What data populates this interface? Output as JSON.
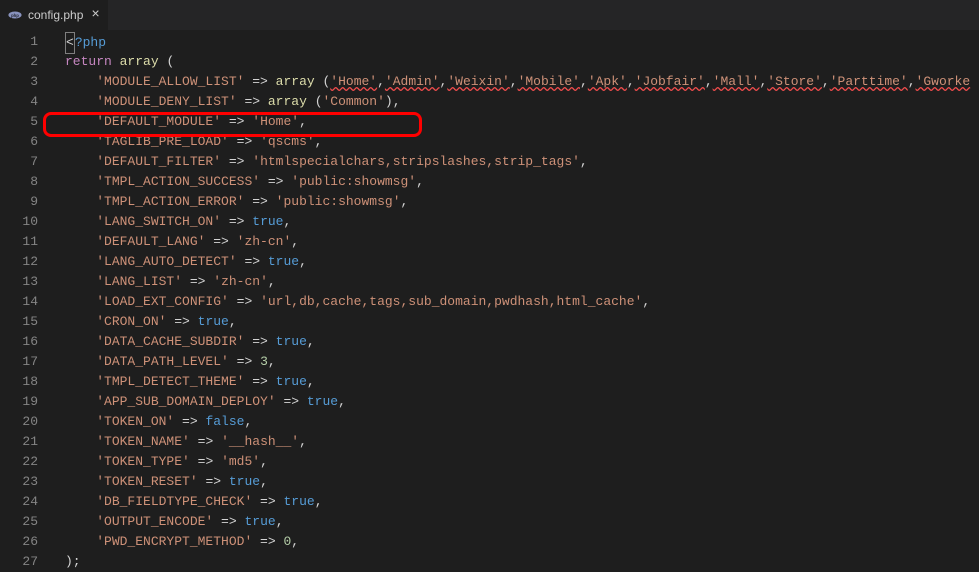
{
  "tab": {
    "label": "config.php",
    "icon": "php-icon"
  },
  "code": {
    "lines": [
      {
        "n": 1,
        "segs": [
          {
            "t": "<",
            "c": "k-punct",
            "box": true
          },
          {
            "t": "?php",
            "c": "k-php"
          }
        ]
      },
      {
        "n": 2,
        "segs": [
          {
            "t": "return",
            "c": "k-purple"
          },
          {
            "t": " ",
            "c": ""
          },
          {
            "t": "array",
            "c": "k-func"
          },
          {
            "t": " (",
            "c": "k-punct"
          }
        ]
      },
      {
        "n": 3,
        "indent": 1,
        "segs": [
          {
            "t": "'MODULE_ALLOW_LIST'",
            "c": "k-string"
          },
          {
            "t": " => ",
            "c": "k-punct"
          },
          {
            "t": "array",
            "c": "k-func"
          },
          {
            "t": " (",
            "c": "k-punct"
          },
          {
            "t": "'Home'",
            "c": "k-string",
            "err": true
          },
          {
            "t": ",",
            "c": "k-punct"
          },
          {
            "t": "'Admin'",
            "c": "k-string",
            "err": true
          },
          {
            "t": ",",
            "c": "k-punct"
          },
          {
            "t": "'Weixin'",
            "c": "k-string",
            "err": true
          },
          {
            "t": ",",
            "c": "k-punct"
          },
          {
            "t": "'Mobile'",
            "c": "k-string",
            "err": true
          },
          {
            "t": ",",
            "c": "k-punct"
          },
          {
            "t": "'Apk'",
            "c": "k-string",
            "err": true
          },
          {
            "t": ",",
            "c": "k-punct"
          },
          {
            "t": "'Jobfair'",
            "c": "k-string",
            "err": true
          },
          {
            "t": ",",
            "c": "k-punct"
          },
          {
            "t": "'Mall'",
            "c": "k-string",
            "err": true
          },
          {
            "t": ",",
            "c": "k-punct"
          },
          {
            "t": "'Store'",
            "c": "k-string",
            "err": true
          },
          {
            "t": ",",
            "c": "k-punct"
          },
          {
            "t": "'Parttime'",
            "c": "k-string",
            "err": true
          },
          {
            "t": ",",
            "c": "k-punct"
          },
          {
            "t": "'Gworke",
            "c": "k-string",
            "err": true
          }
        ]
      },
      {
        "n": 4,
        "indent": 1,
        "segs": [
          {
            "t": "'MODULE_DENY_LIST'",
            "c": "k-string"
          },
          {
            "t": " => ",
            "c": "k-punct"
          },
          {
            "t": "array",
            "c": "k-func"
          },
          {
            "t": " (",
            "c": "k-punct"
          },
          {
            "t": "'Common'",
            "c": "k-string"
          },
          {
            "t": "),",
            "c": "k-punct"
          }
        ]
      },
      {
        "n": 5,
        "indent": 1,
        "segs": [
          {
            "t": "'DEFAULT_MODULE'",
            "c": "k-string"
          },
          {
            "t": " => ",
            "c": "k-punct"
          },
          {
            "t": "'Home'",
            "c": "k-string"
          },
          {
            "t": ",",
            "c": "k-punct"
          }
        ]
      },
      {
        "n": 6,
        "indent": 1,
        "segs": [
          {
            "t": "'TAGLIB_PRE_LOAD'",
            "c": "k-string"
          },
          {
            "t": " => ",
            "c": "k-punct"
          },
          {
            "t": "'qscms'",
            "c": "k-string"
          },
          {
            "t": ",",
            "c": "k-punct"
          }
        ]
      },
      {
        "n": 7,
        "indent": 1,
        "segs": [
          {
            "t": "'DEFAULT_FILTER'",
            "c": "k-string"
          },
          {
            "t": " => ",
            "c": "k-punct"
          },
          {
            "t": "'htmlspecialchars,stripslashes,strip_tags'",
            "c": "k-string"
          },
          {
            "t": ",",
            "c": "k-punct"
          }
        ]
      },
      {
        "n": 8,
        "indent": 1,
        "segs": [
          {
            "t": "'TMPL_ACTION_SUCCESS'",
            "c": "k-string"
          },
          {
            "t": " => ",
            "c": "k-punct"
          },
          {
            "t": "'public:showmsg'",
            "c": "k-string"
          },
          {
            "t": ",",
            "c": "k-punct"
          }
        ]
      },
      {
        "n": 9,
        "indent": 1,
        "segs": [
          {
            "t": "'TMPL_ACTION_ERROR'",
            "c": "k-string"
          },
          {
            "t": " => ",
            "c": "k-punct"
          },
          {
            "t": "'public:showmsg'",
            "c": "k-string"
          },
          {
            "t": ",",
            "c": "k-punct"
          }
        ]
      },
      {
        "n": 10,
        "indent": 1,
        "segs": [
          {
            "t": "'LANG_SWITCH_ON'",
            "c": "k-string"
          },
          {
            "t": " => ",
            "c": "k-punct"
          },
          {
            "t": "true",
            "c": "k-const"
          },
          {
            "t": ",",
            "c": "k-punct"
          }
        ]
      },
      {
        "n": 11,
        "indent": 1,
        "segs": [
          {
            "t": "'DEFAULT_LANG'",
            "c": "k-string"
          },
          {
            "t": " => ",
            "c": "k-punct"
          },
          {
            "t": "'zh-cn'",
            "c": "k-string"
          },
          {
            "t": ",",
            "c": "k-punct"
          }
        ]
      },
      {
        "n": 12,
        "indent": 1,
        "segs": [
          {
            "t": "'LANG_AUTO_DETECT'",
            "c": "k-string"
          },
          {
            "t": " => ",
            "c": "k-punct"
          },
          {
            "t": "true",
            "c": "k-const"
          },
          {
            "t": ",",
            "c": "k-punct"
          }
        ]
      },
      {
        "n": 13,
        "indent": 1,
        "segs": [
          {
            "t": "'LANG_LIST'",
            "c": "k-string"
          },
          {
            "t": " => ",
            "c": "k-punct"
          },
          {
            "t": "'zh-cn'",
            "c": "k-string"
          },
          {
            "t": ",",
            "c": "k-punct"
          }
        ]
      },
      {
        "n": 14,
        "indent": 1,
        "segs": [
          {
            "t": "'LOAD_EXT_CONFIG'",
            "c": "k-string"
          },
          {
            "t": " => ",
            "c": "k-punct"
          },
          {
            "t": "'url,db,cache,tags,sub_domain,pwdhash,html_cache'",
            "c": "k-string"
          },
          {
            "t": ",",
            "c": "k-punct"
          }
        ]
      },
      {
        "n": 15,
        "indent": 1,
        "segs": [
          {
            "t": "'CRON_ON'",
            "c": "k-string"
          },
          {
            "t": " => ",
            "c": "k-punct"
          },
          {
            "t": "true",
            "c": "k-const"
          },
          {
            "t": ",",
            "c": "k-punct"
          }
        ]
      },
      {
        "n": 16,
        "indent": 1,
        "segs": [
          {
            "t": "'DATA_CACHE_SUBDIR'",
            "c": "k-string"
          },
          {
            "t": " => ",
            "c": "k-punct"
          },
          {
            "t": "true",
            "c": "k-const"
          },
          {
            "t": ",",
            "c": "k-punct"
          }
        ]
      },
      {
        "n": 17,
        "indent": 1,
        "segs": [
          {
            "t": "'DATA_PATH_LEVEL'",
            "c": "k-string"
          },
          {
            "t": " => ",
            "c": "k-punct"
          },
          {
            "t": "3",
            "c": "k-num"
          },
          {
            "t": ",",
            "c": "k-punct"
          }
        ]
      },
      {
        "n": 18,
        "indent": 1,
        "segs": [
          {
            "t": "'TMPL_DETECT_THEME'",
            "c": "k-string"
          },
          {
            "t": " => ",
            "c": "k-punct"
          },
          {
            "t": "true",
            "c": "k-const"
          },
          {
            "t": ",",
            "c": "k-punct"
          }
        ]
      },
      {
        "n": 19,
        "indent": 1,
        "segs": [
          {
            "t": "'APP_SUB_DOMAIN_DEPLOY'",
            "c": "k-string"
          },
          {
            "t": " => ",
            "c": "k-punct"
          },
          {
            "t": "true",
            "c": "k-const"
          },
          {
            "t": ",",
            "c": "k-punct"
          }
        ]
      },
      {
        "n": 20,
        "indent": 1,
        "segs": [
          {
            "t": "'TOKEN_ON'",
            "c": "k-string"
          },
          {
            "t": " => ",
            "c": "k-punct"
          },
          {
            "t": "false",
            "c": "k-const"
          },
          {
            "t": ",",
            "c": "k-punct"
          }
        ]
      },
      {
        "n": 21,
        "indent": 1,
        "segs": [
          {
            "t": "'TOKEN_NAME'",
            "c": "k-string"
          },
          {
            "t": " => ",
            "c": "k-punct"
          },
          {
            "t": "'__hash__'",
            "c": "k-string"
          },
          {
            "t": ",",
            "c": "k-punct"
          }
        ]
      },
      {
        "n": 22,
        "indent": 1,
        "segs": [
          {
            "t": "'TOKEN_TYPE'",
            "c": "k-string"
          },
          {
            "t": " => ",
            "c": "k-punct"
          },
          {
            "t": "'md5'",
            "c": "k-string"
          },
          {
            "t": ",",
            "c": "k-punct"
          }
        ]
      },
      {
        "n": 23,
        "indent": 1,
        "segs": [
          {
            "t": "'TOKEN_RESET'",
            "c": "k-string"
          },
          {
            "t": " => ",
            "c": "k-punct"
          },
          {
            "t": "true",
            "c": "k-const"
          },
          {
            "t": ",",
            "c": "k-punct"
          }
        ]
      },
      {
        "n": 24,
        "indent": 1,
        "segs": [
          {
            "t": "'DB_FIELDTYPE_CHECK'",
            "c": "k-string"
          },
          {
            "t": " => ",
            "c": "k-punct"
          },
          {
            "t": "true",
            "c": "k-const"
          },
          {
            "t": ",",
            "c": "k-punct"
          }
        ]
      },
      {
        "n": 25,
        "indent": 1,
        "segs": [
          {
            "t": "'OUTPUT_ENCODE'",
            "c": "k-string"
          },
          {
            "t": " => ",
            "c": "k-punct"
          },
          {
            "t": "true",
            "c": "k-const"
          },
          {
            "t": ",",
            "c": "k-punct"
          }
        ]
      },
      {
        "n": 26,
        "indent": 1,
        "segs": [
          {
            "t": "'PWD_ENCRYPT_METHOD'",
            "c": "k-string"
          },
          {
            "t": " => ",
            "c": "k-punct"
          },
          {
            "t": "0",
            "c": "k-num"
          },
          {
            "t": ",",
            "c": "k-punct"
          }
        ]
      },
      {
        "n": 27,
        "segs": [
          {
            "t": ");",
            "c": "k-punct"
          }
        ]
      }
    ]
  }
}
